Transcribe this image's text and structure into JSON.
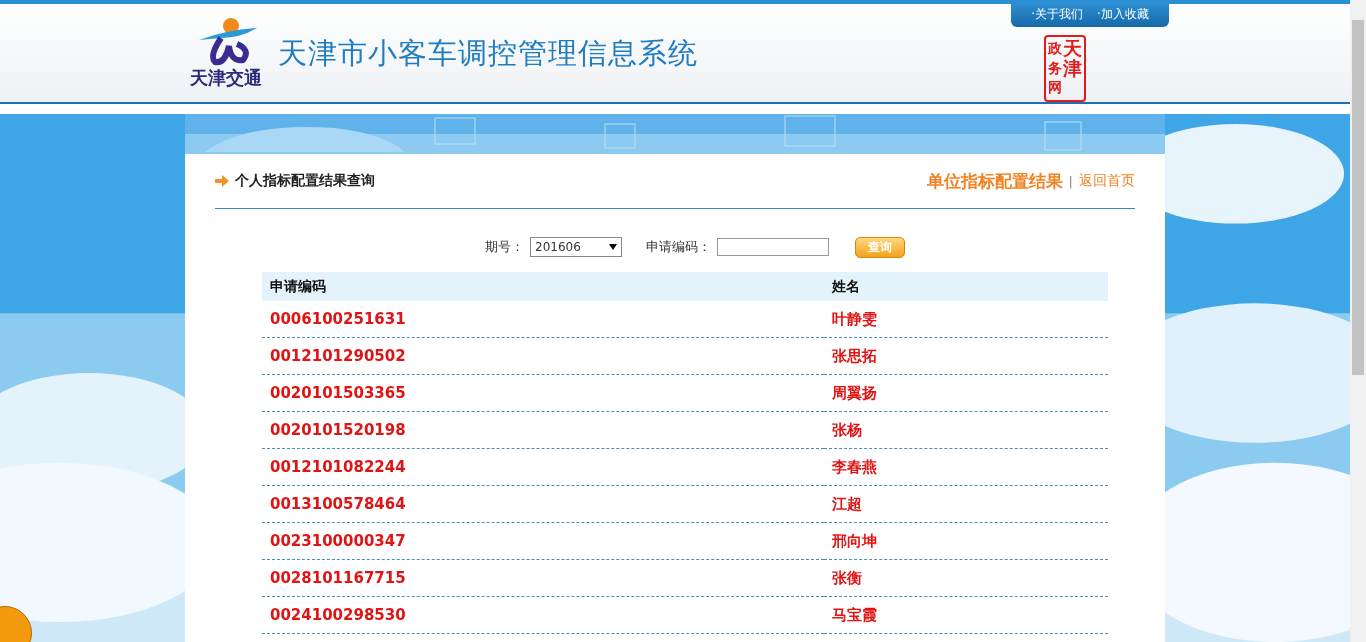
{
  "header": {
    "logo_caption": "天津交通",
    "title": "天津市小客车调控管理信息系统",
    "top_links": [
      "·关于我们",
      "·加入收藏"
    ],
    "seal": {
      "column_1": "政务网",
      "column_2": "天津"
    }
  },
  "section": {
    "title": "个人指标配置结果查询",
    "unit_link": "单位指标配置结果",
    "separator": "|",
    "home_link": "返回首页"
  },
  "query": {
    "period_label": "期号：",
    "period_value": "201606",
    "code_label": "申请编码：",
    "button": "查询"
  },
  "table": {
    "columns": [
      "申请编码",
      "姓名"
    ],
    "rows": [
      [
        "0006100251631",
        "叶静雯"
      ],
      [
        "0012101290502",
        "张思拓"
      ],
      [
        "0020101503365",
        "周翼扬"
      ],
      [
        "0020101520198",
        "张杨"
      ],
      [
        "0012101082244",
        "李春燕"
      ],
      [
        "0013100578464",
        "江超"
      ],
      [
        "0023100000347",
        "邢向坤"
      ],
      [
        "0028101167715",
        "张衡"
      ],
      [
        "0024100298530",
        "马宝霞"
      ]
    ]
  }
}
